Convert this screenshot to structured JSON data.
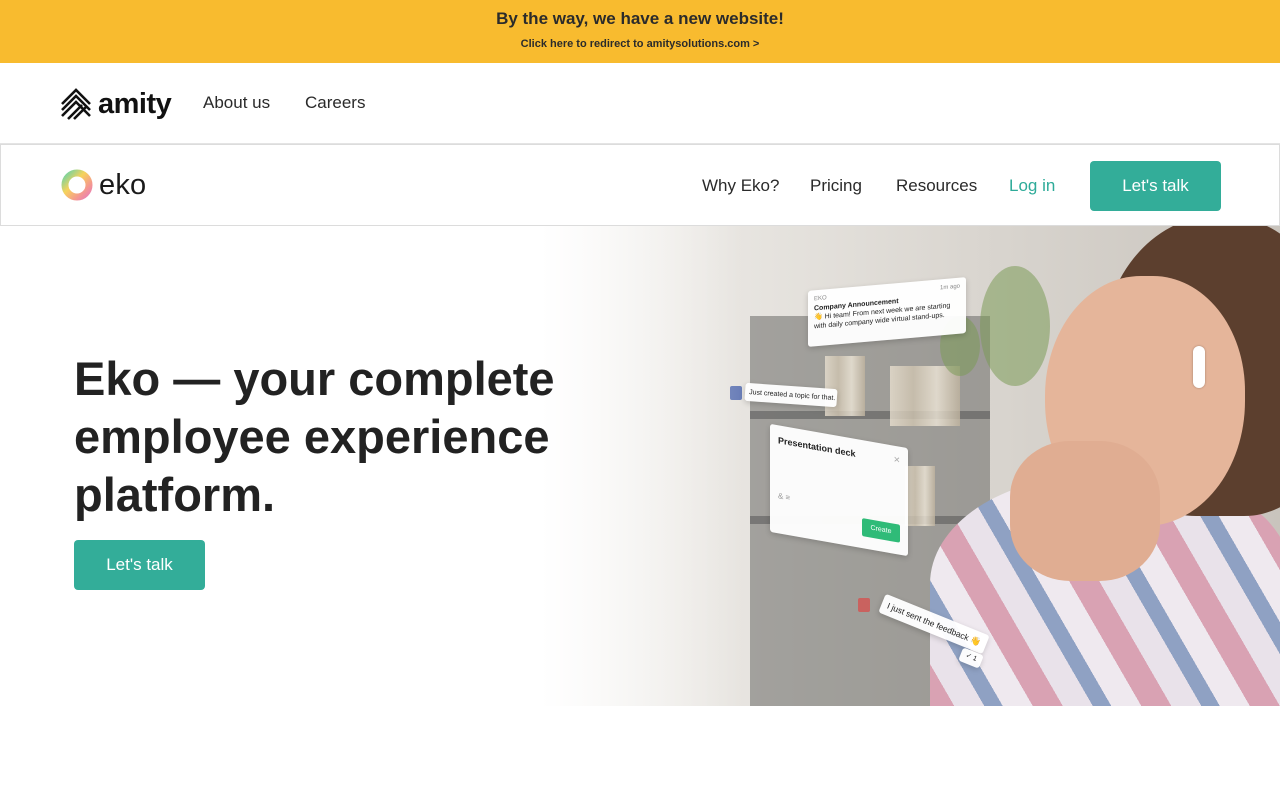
{
  "banner": {
    "title": "By the way, we have a new website!",
    "subtitle": "Click here to redirect to amitysolutions.com >"
  },
  "amity_nav": {
    "logo_text": "amity",
    "links": [
      "About us",
      "Careers"
    ]
  },
  "eko_nav": {
    "logo_text": "eko",
    "links": [
      "Why Eko?",
      "Pricing",
      "Resources"
    ],
    "login_label": "Log in",
    "cta_label": "Let's talk",
    "accent_color": "#33ad99"
  },
  "hero": {
    "title": "Eko — your complete employee experience platform.",
    "cta_label": "Let's talk"
  },
  "hero_cards": {
    "announce_brand": "EKO",
    "announce_time": "1m ago",
    "announce_title": "Company Announcement",
    "announce_body": "👋 Hi team! From next week we are starting with daily company wide virtual stand-ups.",
    "topic_text": "Just created a topic for that.",
    "deck_title": "Presentation deck",
    "deck_close": "×",
    "deck_icons": "& ≡",
    "deck_create": "Create",
    "feedback_text": "I just sent the feedback 👋",
    "feedback_count": "✓ 1"
  },
  "colors": {
    "banner": "#f8bb2f",
    "button": "#33ad99",
    "login_link": "#2eab99"
  }
}
